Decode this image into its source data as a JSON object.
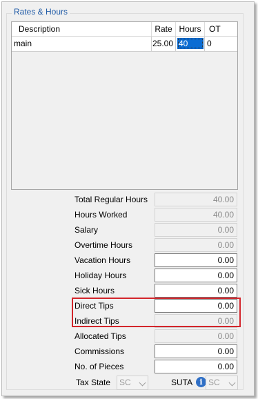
{
  "group_title": "Rates & Hours",
  "grid": {
    "columns": [
      "Description",
      "Rate",
      "Hours",
      "OT"
    ],
    "rows": [
      {
        "description": "main",
        "rate": "25.00",
        "hours": "40",
        "ot": "0"
      }
    ]
  },
  "fields": [
    {
      "label": "Total Regular Hours",
      "value": "40.00",
      "editable": false
    },
    {
      "label": "Hours Worked",
      "value": "40.00",
      "editable": false
    },
    {
      "label": "Salary",
      "value": "0.00",
      "editable": false
    },
    {
      "label": "Overtime Hours",
      "value": "0.00",
      "editable": false
    },
    {
      "label": "Vacation Hours",
      "value": "0.00",
      "editable": true
    },
    {
      "label": "Holiday Hours",
      "value": "0.00",
      "editable": true
    },
    {
      "label": "Sick Hours",
      "value": "0.00",
      "editable": true
    },
    {
      "label": "Direct Tips",
      "value": "0.00",
      "editable": true
    },
    {
      "label": "Indirect Tips",
      "value": "0.00",
      "editable": false
    },
    {
      "label": "Allocated Tips",
      "value": "0.00",
      "editable": false
    },
    {
      "label": "Commissions",
      "value": "0.00",
      "editable": true
    },
    {
      "label": "No. of Pieces",
      "value": "0.00",
      "editable": true
    }
  ],
  "tax_state": {
    "label": "Tax State",
    "value": "SC"
  },
  "suta": {
    "label": "SUTA",
    "value": "SC",
    "icon": "info-icon"
  },
  "colors": {
    "highlight_border": "#d3252b",
    "selection": "#0a6cd3",
    "legend": "#1f5aa6"
  }
}
